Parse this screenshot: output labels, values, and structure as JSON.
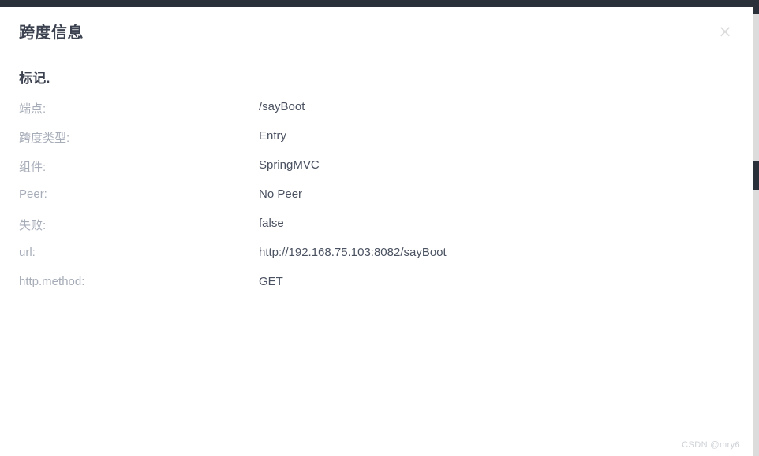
{
  "chrome": {
    "top_bar_color": "#2b313b",
    "scrollbar_track_color": "#dcdcdc",
    "scrollbar_thumb_color": "#2b313b"
  },
  "modal": {
    "title": "跨度信息",
    "close_label": "×",
    "section_heading": "标记.",
    "label_color": "#a7adb8",
    "value_color": "#4a5160",
    "title_color": "#3c4250",
    "rows": [
      {
        "label": "端点:",
        "value": "/sayBoot"
      },
      {
        "label": "跨度类型:",
        "value": "Entry"
      },
      {
        "label": "组件:",
        "value": "SpringMVC"
      },
      {
        "label": "Peer:",
        "value": "No Peer"
      },
      {
        "label": "失败:",
        "value": "false"
      },
      {
        "label": "url:",
        "value": "http://192.168.75.103:8082/sayBoot"
      },
      {
        "label": "http.method:",
        "value": "GET"
      }
    ]
  },
  "watermark": {
    "text": "CSDN @mry6"
  }
}
